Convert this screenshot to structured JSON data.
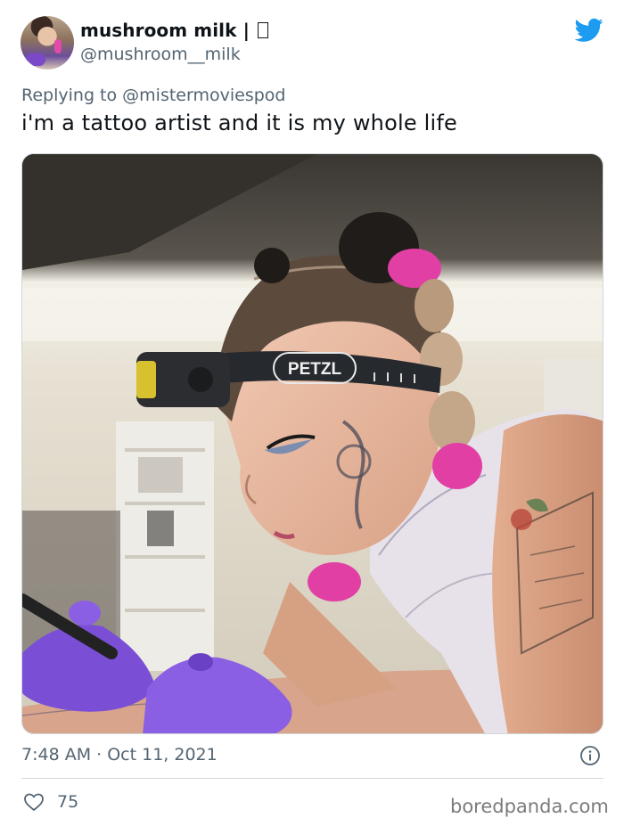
{
  "author": {
    "display_name": "mushroom milk |",
    "handle": "@mushroom__milk"
  },
  "reply": {
    "prefix": "Replying to",
    "mention": "@mistermoviespod"
  },
  "tweet": {
    "text": "i'm a tattoo artist and it is my whole life",
    "timestamp": "7:48 AM · Oct 11, 2021",
    "likes": "75"
  },
  "photo": {
    "headlamp_brand": "PETZL"
  },
  "watermark": "boredpanda.com",
  "icons": {
    "brand": "twitter-bird-icon",
    "info": "info-icon",
    "like": "heart-icon"
  },
  "colors": {
    "twitter_blue": "#1d9bf0",
    "secondary_text": "#536471",
    "primary_text": "#0f1419",
    "glove_purple": "#7a4fd6",
    "hair_pink": "#e23fa5"
  }
}
